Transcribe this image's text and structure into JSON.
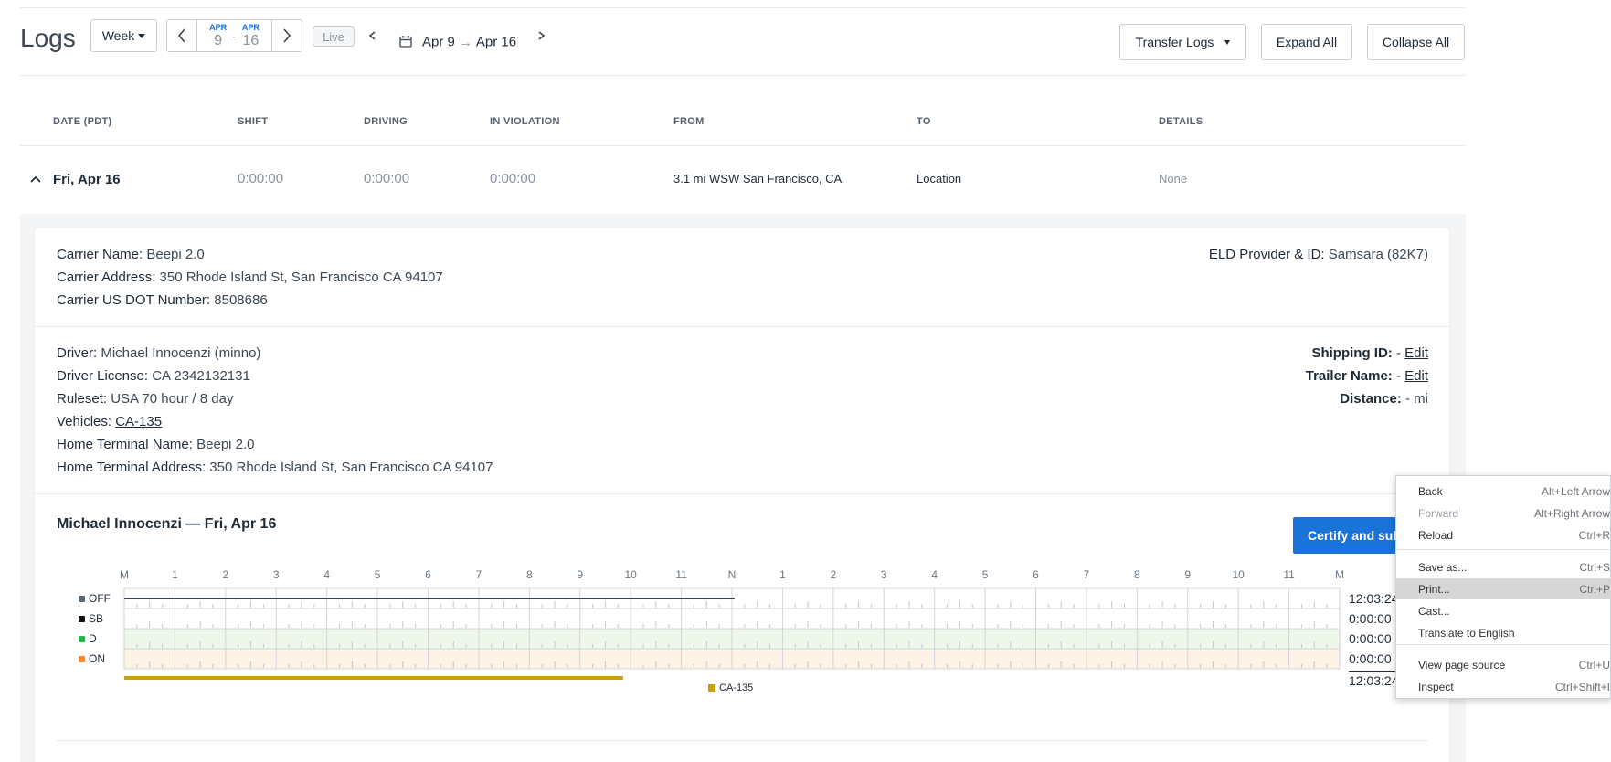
{
  "header": {
    "title": "Logs",
    "period_label": "Week",
    "range_start": {
      "month": "APR",
      "day": "9"
    },
    "range_sep": "-",
    "range_end": {
      "month": "APR",
      "day": "16"
    },
    "live_label": "Live",
    "date_from": "Apr 9",
    "date_to": "Apr 16",
    "transfer_label": "Transfer Logs",
    "expand_label": "Expand All",
    "collapse_label": "Collapse All"
  },
  "table": {
    "columns": [
      "DATE (PDT)",
      "SHIFT",
      "DRIVING",
      "IN VIOLATION",
      "FROM",
      "TO",
      "DETAILS"
    ],
    "row": {
      "date": "Fri, Apr 16",
      "shift": "0:00:00",
      "driving": "0:00:00",
      "violation": "0:00:00",
      "from": "3.1 mi WSW San Francisco, CA",
      "to": "Location",
      "details": "None"
    }
  },
  "carrier": {
    "name_key": "Carrier Name:",
    "name": "Beepi 2.0",
    "address_key": "Carrier Address:",
    "address": "350 Rhode Island St, San Francisco CA 94107",
    "dot_key": "Carrier US DOT Number:",
    "dot": "8508686",
    "eld_key": "ELD Provider & ID:",
    "eld": "Samsara (82K7)"
  },
  "driver": {
    "driver_key": "Driver:",
    "driver": "Michael Innocenzi (minno)",
    "license_key": "Driver License:",
    "license": "CA 2342132131",
    "ruleset_key": "Ruleset:",
    "ruleset": "USA 70 hour / 8 day",
    "vehicles_key": "Vehicles:",
    "vehicles": "CA-135",
    "terminal_name_key": "Home Terminal Name:",
    "terminal_name": "Beepi 2.0",
    "terminal_address_key": "Home Terminal Address:",
    "terminal_address": "350 Rhode Island St, San Francisco CA 94107",
    "shipping_key": "Shipping ID:",
    "shipping": "-",
    "shipping_edit": "Edit",
    "trailer_key": "Trailer Name:",
    "trailer": "-",
    "trailer_edit": "Edit",
    "distance_key": "Distance:",
    "distance": "- mi"
  },
  "log_chart": {
    "title": "Michael Innocenzi — Fri, Apr 16",
    "certify_label": "Certify and submit",
    "hours": [
      "M",
      "1",
      "2",
      "3",
      "4",
      "5",
      "6",
      "7",
      "8",
      "9",
      "10",
      "11",
      "N",
      "1",
      "2",
      "3",
      "4",
      "5",
      "6",
      "7",
      "8",
      "9",
      "10",
      "11",
      "M"
    ],
    "statuses": [
      {
        "label": "OFF",
        "color": "#5b6770",
        "total": "12:03:24"
      },
      {
        "label": "SB",
        "color": "#111111",
        "total": "0:00:00"
      },
      {
        "label": "D",
        "color": "#2db34a",
        "total": "0:00:00"
      },
      {
        "label": "ON",
        "color": "#f28a3c",
        "total": "0:00:00"
      }
    ],
    "grand_total": "12:03:24",
    "off_duty_end_hour": 12.05,
    "vehicle_bar_end_hour": 9.85,
    "vehicle_legend": "CA-135",
    "vehicle_color": "#c9a10a"
  },
  "context_menu": {
    "items": [
      {
        "label": "Back",
        "shortcut": "Alt+Left Arrow",
        "disabled": false
      },
      {
        "label": "Forward",
        "shortcut": "Alt+Right Arrow",
        "disabled": true
      },
      {
        "label": "Reload",
        "shortcut": "Ctrl+R",
        "disabled": false
      },
      {
        "label": "Save as...",
        "shortcut": "Ctrl+S",
        "disabled": false
      },
      {
        "label": "Print...",
        "shortcut": "Ctrl+P",
        "disabled": false
      },
      {
        "label": "Cast...",
        "shortcut": "",
        "disabled": false
      },
      {
        "label": "Translate to English",
        "shortcut": "",
        "disabled": false
      },
      {
        "label": "View page source",
        "shortcut": "Ctrl+U",
        "disabled": false
      },
      {
        "label": "Inspect",
        "shortcut": "Ctrl+Shift+I",
        "disabled": false
      }
    ]
  }
}
